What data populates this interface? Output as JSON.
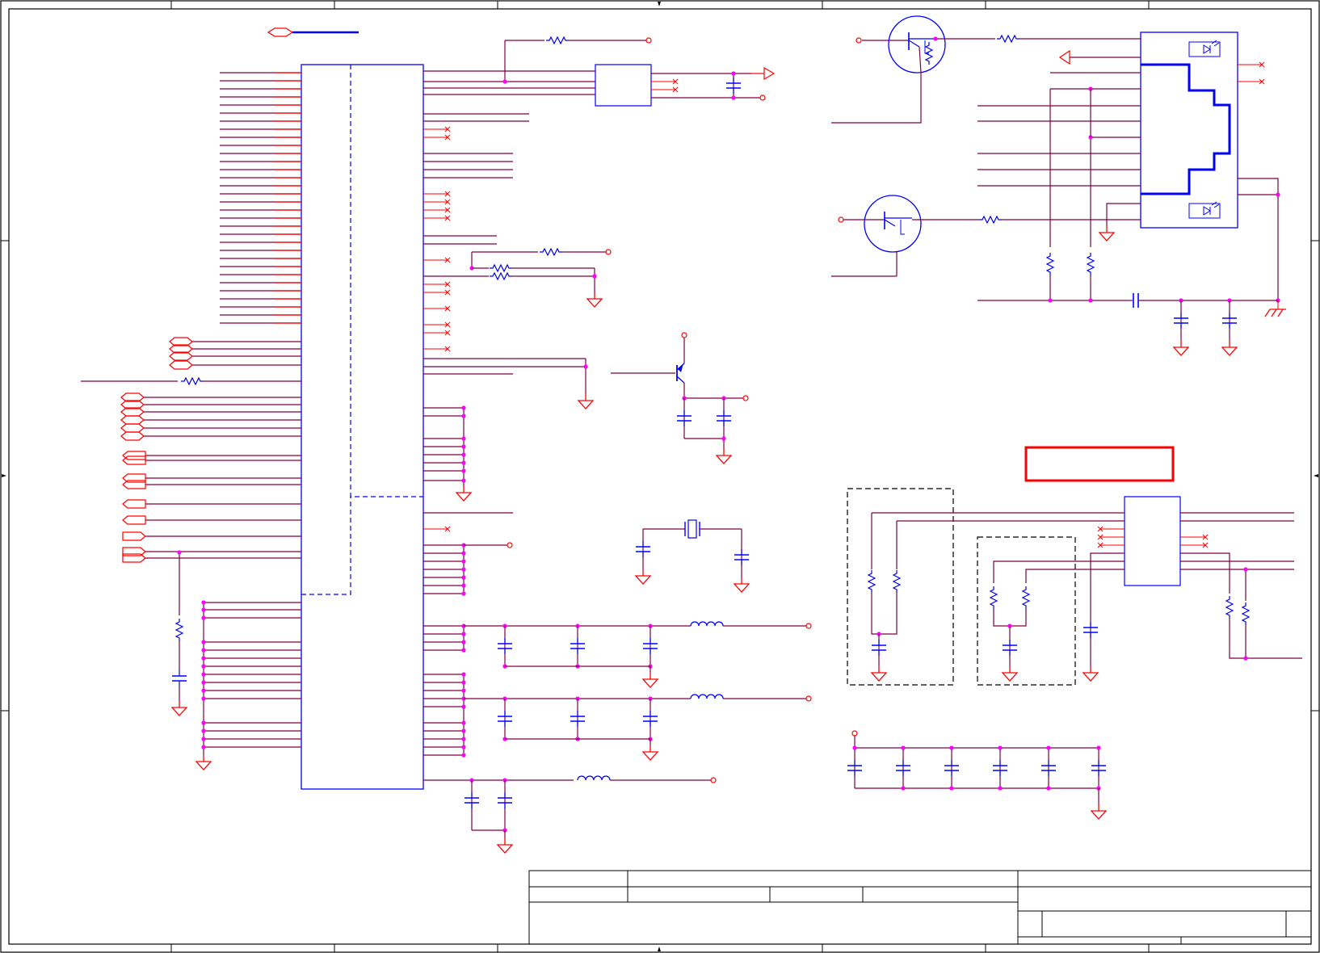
{
  "colors": {
    "background": "#ffffff",
    "frame": "#000000",
    "part_outline": "#0000ff",
    "net_wire": "#800040",
    "pin_stub": "#ff0000",
    "junction": "#ff00ff",
    "highlight_box": "#ff0000"
  },
  "sheet": {
    "title_block_text": []
  },
  "icons": {
    "ground": "ground-icon",
    "chassis_ground": "chassis-ground-icon",
    "resistor": "resistor-icon",
    "capacitor": "capacitor-icon",
    "inductor": "inductor-icon",
    "crystal": "crystal-icon",
    "transistor": "transistor-icon",
    "power_connector": "power-connector-icon",
    "offpage_port": "offpage-port-icon",
    "no_connect": "no-connect-icon"
  }
}
